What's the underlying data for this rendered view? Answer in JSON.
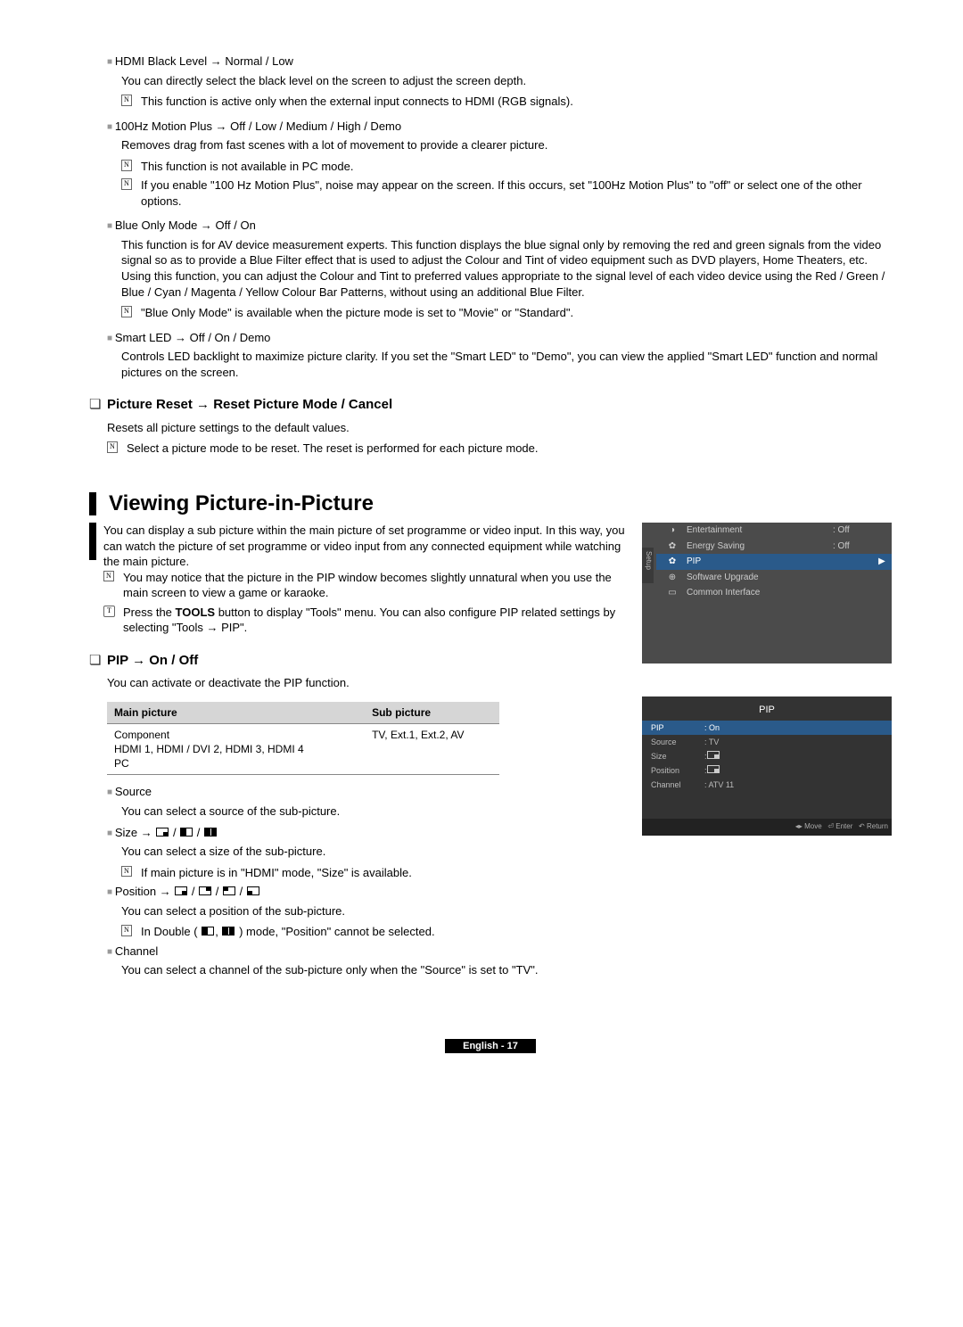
{
  "s1": {
    "hdmi_title": "HDMI Black Level → Normal / Low",
    "hdmi_desc": "You can directly select the black level on the screen to adjust the screen depth.",
    "hdmi_note": "This function is active only when the external input connects to HDMI (RGB signals).",
    "mp_title": "100Hz Motion Plus → Off / Low / Medium / High / Demo",
    "mp_desc": "Removes drag from fast scenes with a lot of movement to provide a clearer picture.",
    "mp_note1": "This function is not available in PC mode.",
    "mp_note2": "If you enable \"100 Hz Motion Plus\", noise may appear on the screen. If this occurs, set \"100Hz Motion Plus\" to \"off\" or select one of the other options.",
    "blue_title": "Blue Only Mode → Off / On",
    "blue_desc": "This function is for AV device measurement experts. This function displays the blue signal only by removing the red and green signals from the video signal so as to provide a Blue Filter effect that is used to adjust the Colour and Tint of video equipment such as DVD players, Home Theaters, etc. Using this function, you can adjust the Colour and Tint to preferred values appropriate to the signal level of each video device using the Red / Green / Blue / Cyan / Magenta / Yellow Colour Bar Patterns, without using an additional Blue Filter.",
    "blue_note": "\"Blue Only Mode\" is available when the picture mode is set to \"Movie\" or \"Standard\".",
    "sled_title": "Smart LED → Off / On / Demo",
    "sled_desc": "Controls LED backlight to maximize picture clarity. If you set the \"Smart LED\" to \"Demo\", you can view the applied \"Smart LED\" function and normal pictures on the screen."
  },
  "reset": {
    "heading": "Picture Reset → Reset Picture Mode / Cancel",
    "desc": "Resets all picture settings to the default values.",
    "note": "Select a picture mode to be reset. The reset is performed for each picture mode."
  },
  "pip": {
    "heading": "Viewing Picture-in-Picture",
    "intro": "You can display a sub picture within the main picture of set programme or video input. In this way, you can watch the picture of set programme or video input from any connected equipment while watching the main picture.",
    "n1": "You may notice that the picture in the PIP window becomes slightly unnatural when you use the main screen to view a game or karaoke.",
    "t1a": "Press the ",
    "t1b": "TOOLS",
    "t1c": " button to display \"Tools\" menu. You can also configure PIP related settings by selecting \"Tools → PIP\".",
    "sub_heading": "PIP → On / Off",
    "sub_desc": "You can activate or deactivate the PIP function.",
    "table": {
      "h1": "Main picture",
      "h2": "Sub picture",
      "c1": "Component\nHDMI 1, HDMI / DVI 2, HDMI 3, HDMI 4\nPC",
      "c2": "TV, Ext.1, Ext.2, AV"
    },
    "source_t": "Source",
    "source_d": "You can select a source of the sub-picture.",
    "size_t": "Size → ",
    "size_d": "You can select a size of the sub-picture.",
    "size_n": "If main picture is in \"HDMI\" mode, \"Size\" is available.",
    "pos_t": "Position → ",
    "pos_d": "You can select a position of the sub-picture.",
    "pos_n_a": "In Double ( ",
    "pos_n_b": " ) mode, \"Position\" cannot be selected.",
    "ch_t": "Channel",
    "ch_d": "You can select a channel of the sub-picture only when the \"Source\" is set to \"TV\"."
  },
  "osd1": {
    "setup": "Setup",
    "ent": "Entertainment",
    "ent_v": ": Off",
    "es": "Energy Saving",
    "es_v": ": Off",
    "pip": "PIP",
    "su": "Software Upgrade",
    "ci": "Common Interface"
  },
  "osd2": {
    "title": "PIP",
    "pip": "PIP",
    "pip_v": ": On",
    "src": "Source",
    "src_v": ": TV",
    "size": "Size",
    "size_v": ":",
    "pos": "Position",
    "pos_v": ":",
    "ch": "Channel",
    "ch_v": ": ATV 11",
    "move": "Move",
    "enter": "Enter",
    "return": "Return"
  },
  "footer": "English - 17"
}
